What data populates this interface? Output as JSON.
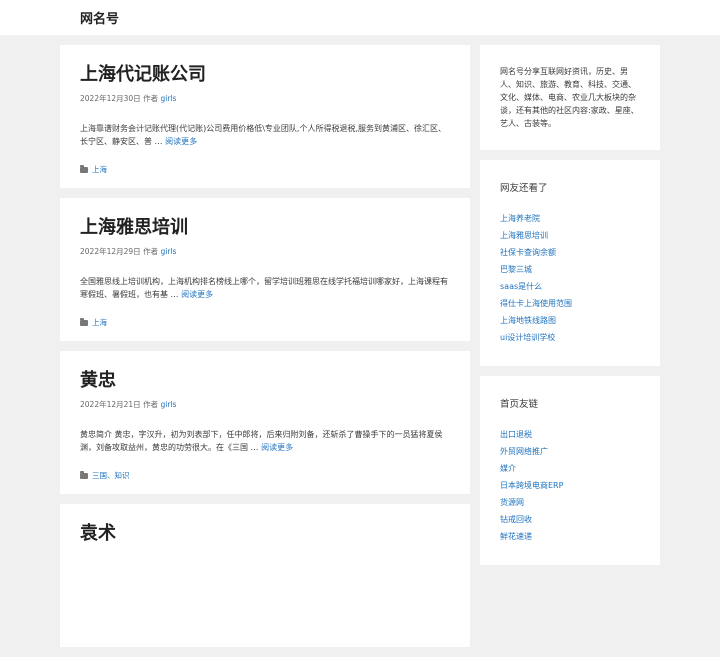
{
  "site": {
    "title": "网名号"
  },
  "posts": [
    {
      "title": "上海代记账公司",
      "date": "2022年12月30日",
      "author_prefix": "作者",
      "author": "girls",
      "excerpt": "上海靠谱财务会计记账代理(代记账)公司费用价格低\\专业团队,个人所得税退税,服务到黄浦区、徐汇区、长宁区、静安区、普 …",
      "read_more": "阅读更多",
      "categories": "上海"
    },
    {
      "title": "上海雅思培训",
      "date": "2022年12月29日",
      "author_prefix": "作者",
      "author": "girls",
      "excerpt": "全国雅思线上培训机构，上海机构排名榜线上哪个，留学培训班雅思在线学托福培训哪家好，上海课程有寒假班、暑假班，也有基 …",
      "read_more": "阅读更多",
      "categories": "上海"
    },
    {
      "title": "黄忠",
      "date": "2022年12月21日",
      "author_prefix": "作者",
      "author": "girls",
      "excerpt": "黄忠简介 黄忠，字汉升，初为刘表部下，任中郎将，后来归附刘备，还斩杀了曹操手下的一员猛将夏侯渊，刘备攻取益州，黄忠的功劳很大。在《三国 …",
      "read_more": "阅读更多",
      "categories": "三国、知识"
    },
    {
      "title": "袁术"
    }
  ],
  "sidebar": {
    "about": "网名号分享互联网好资讯，历史、男人、知识、旅游、教育、科技、交通、文化、媒体、电商、农业几大板块的杂谈，还有其他的社区内容:家政、星座、艺人、古装等。",
    "also_viewed": {
      "title": "网友还看了",
      "items": [
        "上海养老院",
        "上海雅思培训",
        "社保卡查询余额",
        "巴黎三城",
        "saas是什么",
        "得仕卡上海使用范围",
        "上海地铁线路图",
        "ui设计培训学校"
      ]
    },
    "friend_links": {
      "title": "首页友链",
      "items": [
        "出口退税",
        "外贸网络推广",
        "媒介",
        "日本跨境电商ERP",
        "货源网",
        "钻戒回收",
        "鲜花速递"
      ]
    }
  }
}
